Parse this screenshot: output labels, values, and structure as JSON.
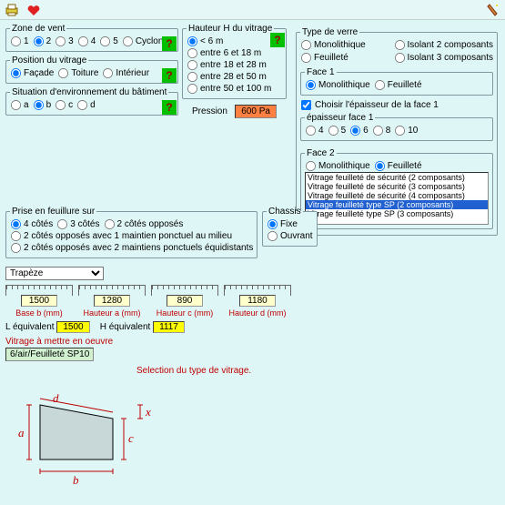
{
  "toolbar": {
    "print_icon": "printer-icon",
    "heart_icon": "heart-icon",
    "wizard_icon": "wizard-icon"
  },
  "zone_vent": {
    "legend": "Zone de vent",
    "options": [
      "1",
      "2",
      "3",
      "4",
      "5",
      "Cyclone"
    ],
    "selected": "2"
  },
  "position": {
    "legend": "Position du vitrage",
    "options": [
      "Façade",
      "Toiture",
      "Intérieur"
    ],
    "selected": "Façade"
  },
  "situation": {
    "legend": "Situation d'environnement du bâtiment",
    "options": [
      "a",
      "b",
      "c",
      "d"
    ],
    "selected": "b"
  },
  "hauteur": {
    "legend": "Hauteur H du vitrage",
    "options": [
      "< 6 m",
      "entre 6 et 18 m",
      "entre 18 et 28 m",
      "entre 28 et 50 m",
      "entre 50 et 100 m"
    ],
    "selected": "< 6 m"
  },
  "pression": {
    "label": "Pression",
    "value": "600 Pa"
  },
  "type_verre": {
    "legend": "Type de verre",
    "options": [
      "Monolithique",
      "Isolant 2 composants",
      "Feuilleté",
      "Isolant 3 composants"
    ],
    "selected": ""
  },
  "face1": {
    "legend": "Face 1",
    "options": [
      "Monolithique",
      "Feuilleté"
    ],
    "selected": "Monolithique",
    "choisir_label": "Choisir l'épaisseur de la face 1",
    "choisir_checked": true,
    "epaisseur_legend": "épaisseur face 1",
    "epaisseur_options": [
      "4",
      "5",
      "6",
      "8",
      "10"
    ],
    "epaisseur_selected": "6"
  },
  "face2": {
    "legend": "Face 2",
    "options": [
      "Monolithique",
      "Feuilleté"
    ],
    "selected": "Feuilleté",
    "list": [
      "Vitrage feuilleté de sécurité (2 composants)",
      "Vitrage feuilleté de sécurité (3 composants)",
      "Vitrage feuilleté de sécurité (4 composants)",
      "Vitrage feuilleté type SP (2 composants)",
      "Vitrage feuilleté type SP (3 composants)"
    ],
    "list_selected_index": 3
  },
  "prise": {
    "legend": "Prise en feuillure sur",
    "options": [
      "4 côtés",
      "3 côtés",
      "2 côtés opposés",
      "2 côtés opposés avec 1 maintien ponctuel au milieu",
      "2 côtés opposés avec 2 maintiens ponctuels équidistants"
    ],
    "selected": "4 côtés"
  },
  "chassis": {
    "legend": "Chassis",
    "options": [
      "Fixe",
      "Ouvrant"
    ],
    "selected": "Fixe"
  },
  "shape": {
    "selected": "Trapèze"
  },
  "dims": [
    {
      "value": "1500",
      "label": "Base b (mm)"
    },
    {
      "value": "1280",
      "label": "Hauteur a (mm)"
    },
    {
      "value": "890",
      "label": "Hauteur c (mm)"
    },
    {
      "value": "1180",
      "label": "Hauteur d (mm)"
    }
  ],
  "equiv": {
    "l_label": "L équivalent",
    "l_value": "1500",
    "h_label": "H équivalent",
    "h_value": "1117"
  },
  "vitrage": {
    "title": "Vitrage à mettre en oeuvre",
    "result": "6/air/Feuilleté SP10"
  },
  "selection_msg": "Selection du type de vitrage.",
  "diagram_labels": {
    "a": "a",
    "b": "b",
    "c": "c",
    "d": "d",
    "x": "x"
  }
}
